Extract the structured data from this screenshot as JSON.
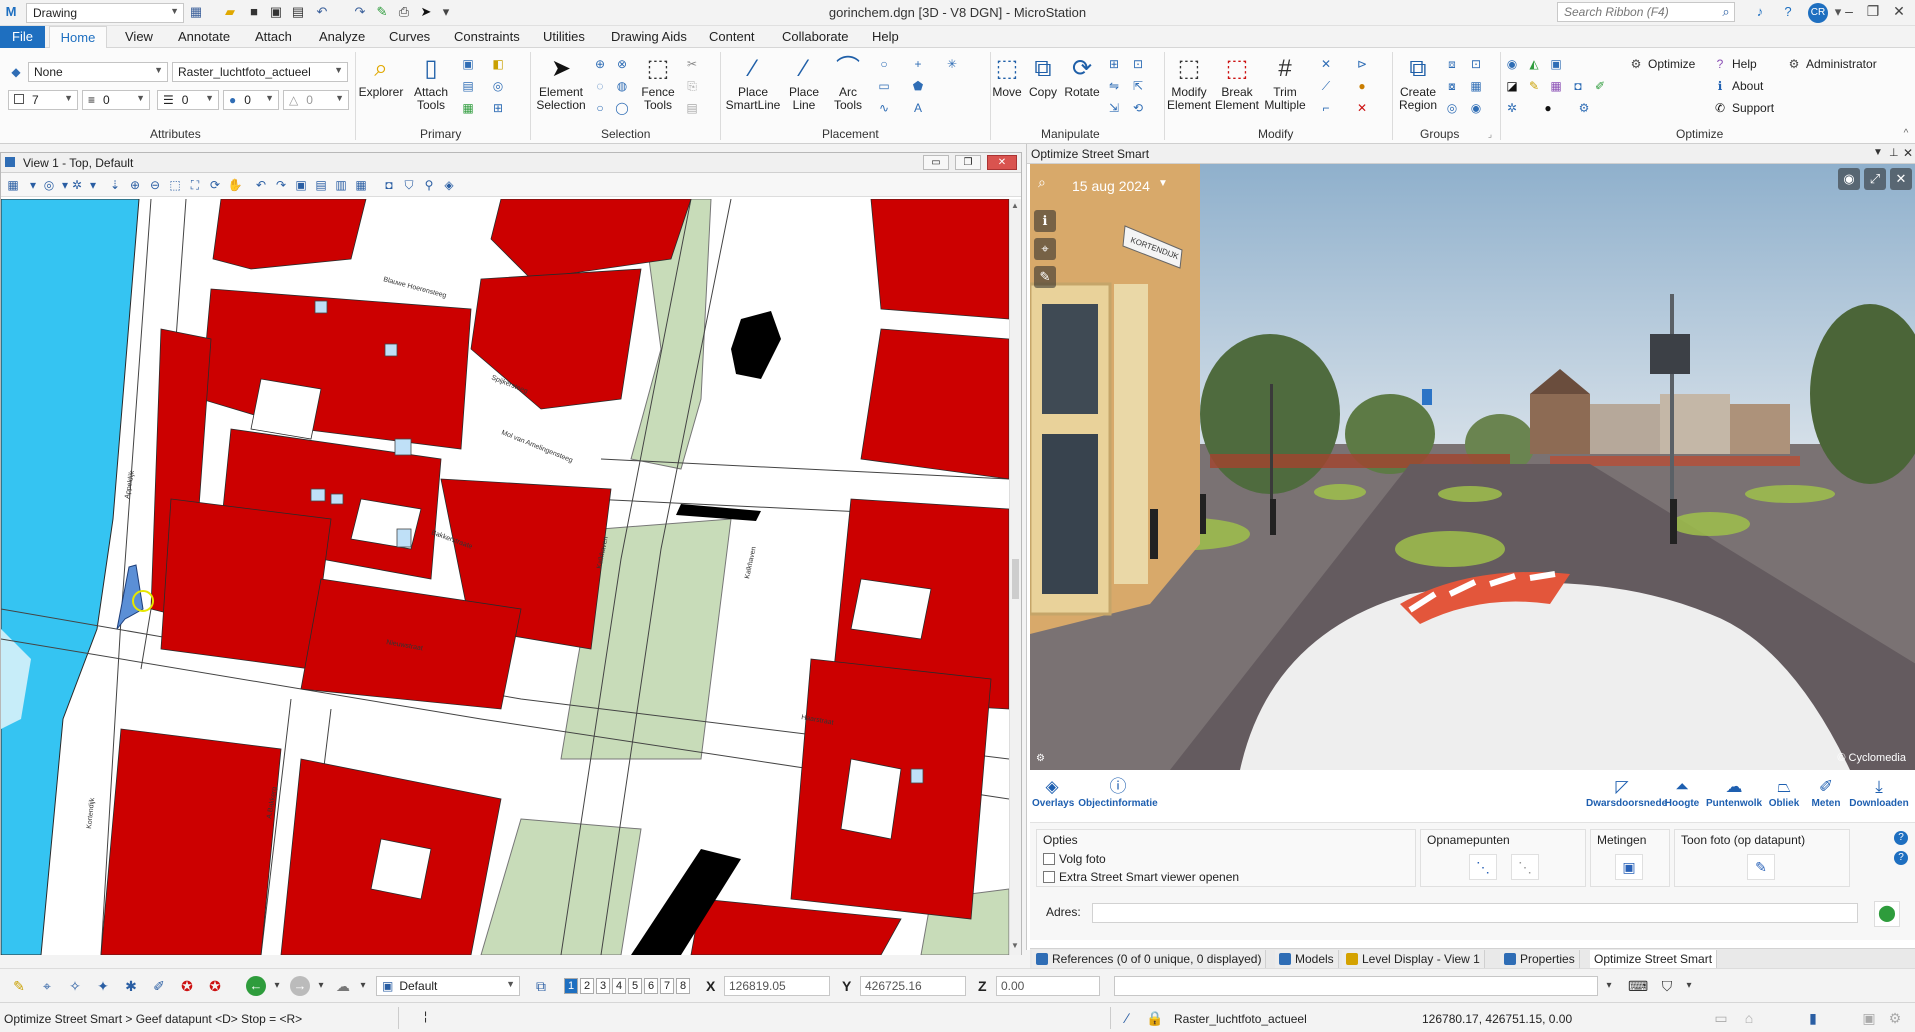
{
  "titlebar": {
    "workflow_combo": "Drawing",
    "window_title": "gorinchem.dgn [3D - V8 DGN] - MicroStation",
    "search_placeholder": "Search Ribbon (F4)",
    "user_initials": "CR"
  },
  "menu": {
    "tabs": [
      "File",
      "Home",
      "View",
      "Annotate",
      "Attach",
      "Analyze",
      "Curves",
      "Constraints",
      "Utilities",
      "Drawing Aids",
      "Content",
      "Collaborate",
      "Help"
    ]
  },
  "ribbon": {
    "attributes": {
      "label": "Attributes",
      "level_none": "None",
      "level_active": "Raster_luchtfoto_actueel",
      "color_value": "7",
      "style_value": "0",
      "weight_value": "0",
      "transparency_value": "0",
      "priority_value": "0"
    },
    "primary": {
      "label": "Primary",
      "explorer": "Explorer",
      "attach_tools": "Attach\nTools"
    },
    "selection": {
      "label": "Selection",
      "element_selection": "Element\nSelection",
      "fence_tools": "Fence\nTools"
    },
    "placement": {
      "label": "Placement",
      "place_smartline": "Place\nSmartLine",
      "place_line": "Place\nLine",
      "arc_tools": "Arc\nTools"
    },
    "manipulate": {
      "label": "Manipulate",
      "move": "Move",
      "copy": "Copy",
      "rotate": "Rotate"
    },
    "modify": {
      "label": "Modify",
      "modify_element": "Modify\nElement",
      "break_element": "Break\nElement",
      "trim_multiple": "Trim\nMultiple"
    },
    "groups": {
      "label": "Groups",
      "create_region": "Create\nRegion"
    },
    "optimize": {
      "label": "Optimize",
      "optimize": "Optimize",
      "help": "Help",
      "about": "About",
      "support": "Support",
      "administrator": "Administrator"
    }
  },
  "view1": {
    "title": "View 1 - Top, Default",
    "streets": [
      "Blauwe Hoerensteeg",
      "Spijkersteeg",
      "Mol van Amelingensteeg",
      "Bakkerstraate",
      "Appeldijk",
      "Kalkhaven",
      "Kalkhaven",
      "Nieuwstraat",
      "Kortendijk",
      "A.Bakkerg",
      "Haarstraat"
    ]
  },
  "streetsmart": {
    "panel_title": "Optimize Street Smart",
    "date": "15 aug 2024",
    "street_sign": "KORTENDIJK",
    "copyright": "© Cyclomedia",
    "tools_left": [
      "Overlays",
      "Objectinformatie"
    ],
    "tools_right": [
      "Dwarsdoorsnede",
      "Hoogte",
      "Puntenwolk",
      "Obliek",
      "Meten",
      "Downloaden"
    ],
    "options": {
      "title": "Opties",
      "volg_foto": "Volg foto",
      "extra_viewer": "Extra Street Smart viewer openen"
    },
    "opnamepunten": "Opnamepunten",
    "metingen": "Metingen",
    "toon_foto": "Toon foto (op datapunt)",
    "adres_label": "Adres:",
    "adres_value": ""
  },
  "panel_tabs": [
    "References (0 of 0 unique, 0 displayed)",
    "Models",
    "Level Display - View 1",
    "Properties",
    "Optimize Street Smart"
  ],
  "bottom": {
    "view_combo": "Default",
    "view_numbers": [
      "1",
      "2",
      "3",
      "4",
      "5",
      "6",
      "7",
      "8"
    ],
    "x_label": "X",
    "x_value": "126819.05",
    "y_label": "Y",
    "y_value": "426725.16",
    "z_label": "Z",
    "z_value": "0.00",
    "input_field": ""
  },
  "status": {
    "prompt": "Optimize Street Smart > Geef datapunt <D> Stop = <R>",
    "active_level": "Raster_luchtfoto_actueel",
    "coordinates": "126780.17, 426751.15, 0.00"
  },
  "colors": {
    "accent": "#1e6fc0",
    "building": "#cc0000",
    "water": "#35c4f2",
    "green": "#c8dcb9"
  }
}
